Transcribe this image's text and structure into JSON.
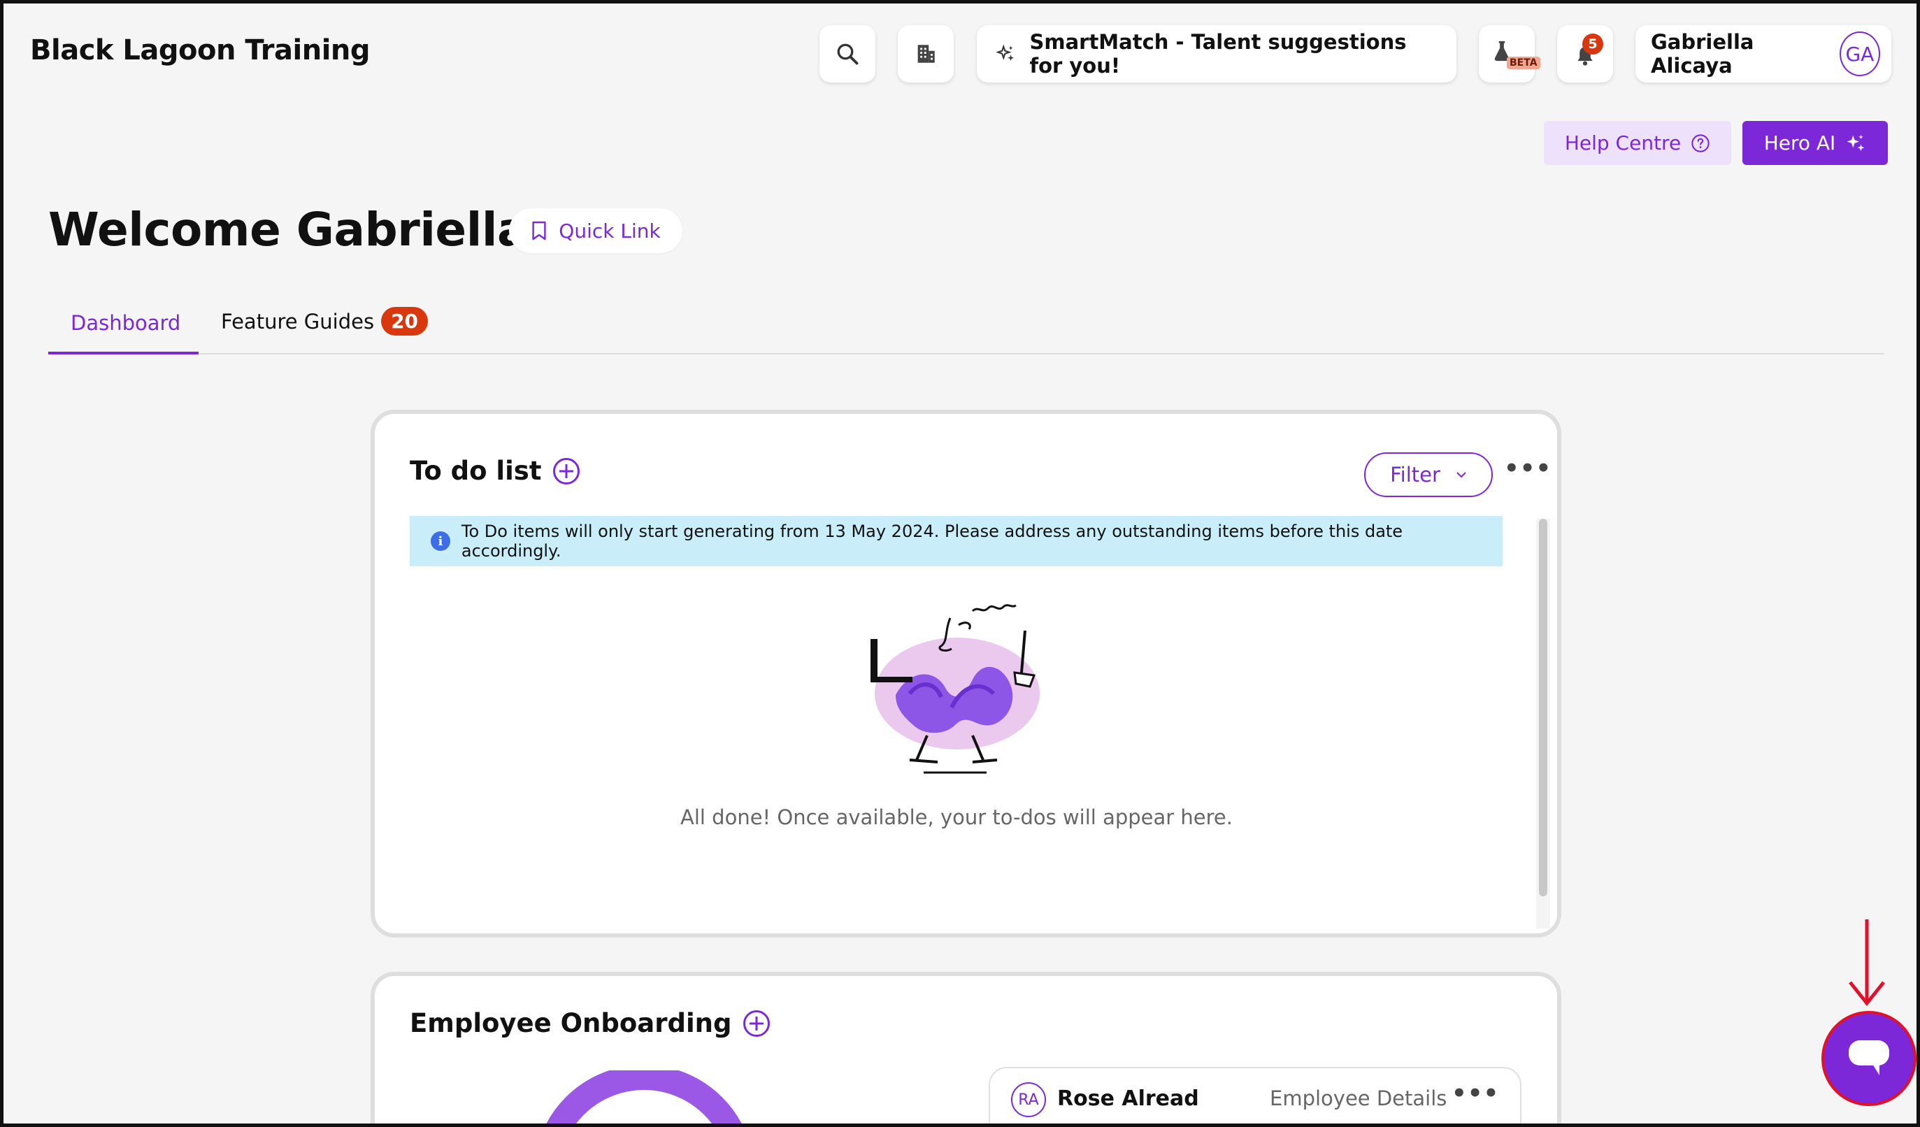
{
  "app": {
    "title": "Black Lagoon Training"
  },
  "topbar": {
    "smartmatch_label": "SmartMatch - Talent suggestions for you!",
    "beta_label": "BETA",
    "notification_count": "5",
    "user_name": "Gabriella Alicaya",
    "user_initials": "GA"
  },
  "actions": {
    "help_label": "Help Centre",
    "hero_label": "Hero AI"
  },
  "welcome": {
    "title": "Welcome Gabriella",
    "quick_link_label": "Quick Link"
  },
  "tabs": [
    {
      "label": "Dashboard",
      "active": true
    },
    {
      "label": "Feature Guides",
      "count": "20"
    }
  ],
  "todo": {
    "title": "To do list",
    "filter_label": "Filter",
    "more": "•••",
    "info": "To Do items will only start generating from 13 May 2024. Please address any outstanding items before this date accordingly.",
    "empty_message": "All done! Once available, your to-dos will appear here."
  },
  "onboarding": {
    "title": "Employee Onboarding",
    "employee_initials": "RA",
    "employee_name": "Rose Alread",
    "details_label": "Employee Details",
    "more": "•••"
  },
  "colors": {
    "accent": "#7c28d8",
    "badge": "#d9380f",
    "info_bg": "#c9eef9",
    "highlight": "#e3102a"
  }
}
